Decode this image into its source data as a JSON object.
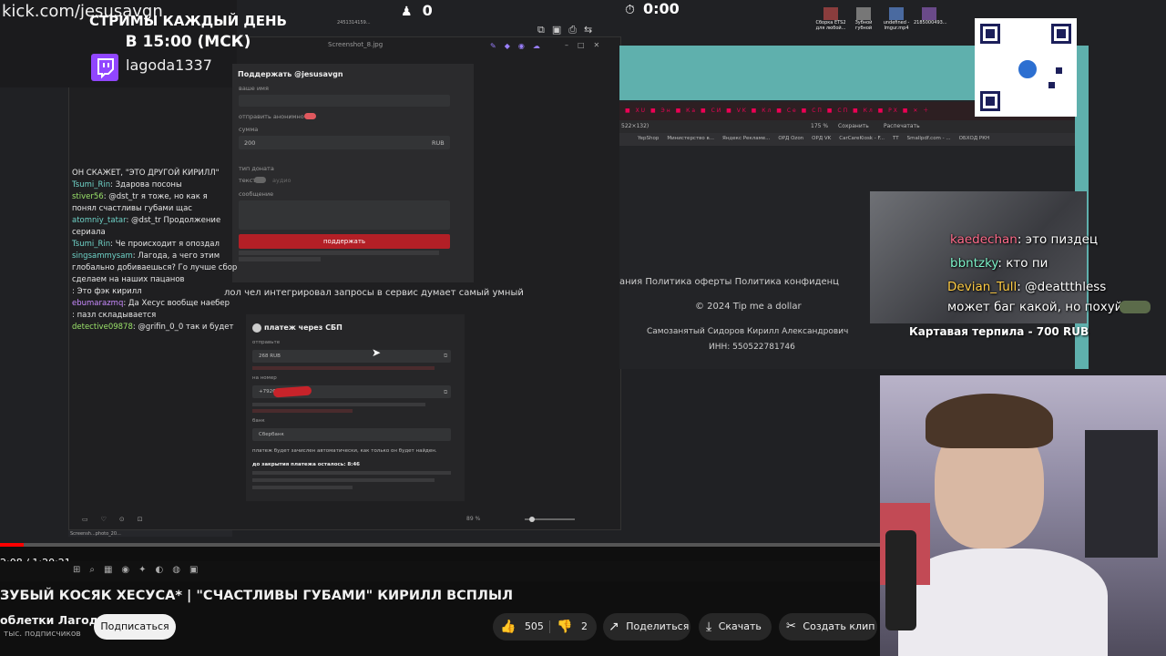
{
  "overlay": {
    "url": "kick.com/jesusavgn",
    "banner_line1": "СТРИМЫ КАЖДЫЙ ДЕНЬ",
    "banner_line2": "В 15:00 (МСК)",
    "twitch_name": "lagoda1337",
    "counter": "0",
    "timer": "0:00"
  },
  "viewer": {
    "title": "Screenshot_8.jpg",
    "footer_file": "Screensh...photo_20...",
    "zoom": "89 %"
  },
  "donate_form": {
    "title": "Поддержать @jesusavgn",
    "name_label": "ваше имя",
    "anon_label": "отправить анонимно",
    "sum_label": "сумма",
    "sum_value": "200",
    "currency": "RUB",
    "type_label": "тип доната",
    "type_text": "текст",
    "type_audio": "аудио",
    "message_label": "сообщение",
    "button": "поддержать"
  },
  "caption": "лол чел интегрировал запросы в сервис думает самый умный",
  "sbp": {
    "title": "платеж через СБП",
    "send_label": "отправьте",
    "amount": "268 RUB",
    "to_label": "на номер",
    "number": "+7926",
    "bank_label": "банк",
    "bank": "Сбербанк",
    "auto_note": "платеж будет зачислен автоматически, как только он будет найден.",
    "remaining": "до закрытия платежа осталось: 8:46"
  },
  "chat": [
    {
      "user": "",
      "text": "ОН СКАЖЕТ, \"ЭТО ДРУГОЙ КИРИЛЛ\"",
      "color": "#dddddd"
    },
    {
      "user": "Tsumi_Rin",
      "text": ": Здарова посоны",
      "color": "#6fd3c8"
    },
    {
      "user": "stiver56",
      "text": ": @dst_tr я тоже, но как я",
      "color": "#9be36a"
    },
    {
      "user": "",
      "text": "понял счастливы губами щас",
      "color": "#dddddd"
    },
    {
      "user": "atomniy_tatar",
      "text": ": @dst_tr Продолжение",
      "color": "#6fd3c8"
    },
    {
      "user": "",
      "text": "сериала",
      "color": "#dddddd"
    },
    {
      "user": "Tsumi_Rin",
      "text": ": Че происходит я опоздал",
      "color": "#6fd3c8"
    },
    {
      "user": "singsammysam",
      "text": ": Лагода, а чего этим",
      "color": "#6fd3c8"
    },
    {
      "user": "",
      "text": "глобально добиваешься? Го лучше сбор",
      "color": "#dddddd"
    },
    {
      "user": "",
      "text": "сделаем на наших пацанов",
      "color": "#dddddd"
    },
    {
      "user": "",
      "text": ": Это фэк кирилл",
      "color": "#dddddd"
    },
    {
      "user": "ebumarazmq",
      "text": ": Да Хесус вообще наебер",
      "color": "#c98bff"
    },
    {
      "user": "",
      "text": ": пазл складывается",
      "color": "#dddddd"
    },
    {
      "user": "detective09878",
      "text": ": @grifin_0_0 так и будет",
      "color": "#9be36a"
    }
  ],
  "tipme": {
    "links": "ания   Политика оферты   Политика конфиденц",
    "copyright": "© 2024 Tip me a dollar",
    "selfemployed": "Самозанятый Сидоров Кирилл Александрович",
    "inn": "ИНН: 550522781746",
    "zoom": "175 %",
    "save": "Сохранить",
    "print": "Распечатать",
    "size": "522×132)",
    "bookmarks": [
      "YepShop",
      "Министерство в...",
      "Яндекс Рекламе...",
      "ОРД Ozon",
      "ОРД VK",
      "CarCareKiosk - F...",
      "TT",
      "Smallpdf.com - ...",
      "ОБХОД РКН"
    ]
  },
  "overlay_chat": [
    {
      "user": "kaedechan",
      "text": ": это пиздец",
      "color": "#ff6b8a"
    },
    {
      "user": "bbntzky",
      "text": ": кто пи",
      "color": "#7df3c9"
    },
    {
      "user": "Devian_Tull",
      "text": ": @deattthless",
      "color": "#ffcc44"
    },
    {
      "user": "",
      "text": "может баг какой, но похуй",
      "color": "#ffffff"
    }
  ],
  "donation_alert": "Картавая терпила - 700 RUB",
  "desktop_icons": [
    "Сборка ETS2 для любой...",
    "Зубной губной",
    "undefined - Imgur.mp4",
    "2185000493..."
  ],
  "player": {
    "time": "2:08 / 1:20:21",
    "title": "ЗУБЫЙ КОСЯК ХЕСУСА* | \"СЧАСТЛИВЫ ГУБАМИ\" КИРИЛЛ ВСПЛЫЛ",
    "channel": "облетки Лагоды",
    "subscribers": "тыс. подписчиков",
    "subscribe": "Подписаться",
    "likes": "505",
    "dislikes": "2",
    "share": "Поделиться",
    "download": "Скачать",
    "clip": "Создать клип",
    "progress": 0.027
  },
  "colors": {
    "accent_red": "#ff0000",
    "twitch": "#9146ff",
    "donate_red": "#b31f26"
  }
}
